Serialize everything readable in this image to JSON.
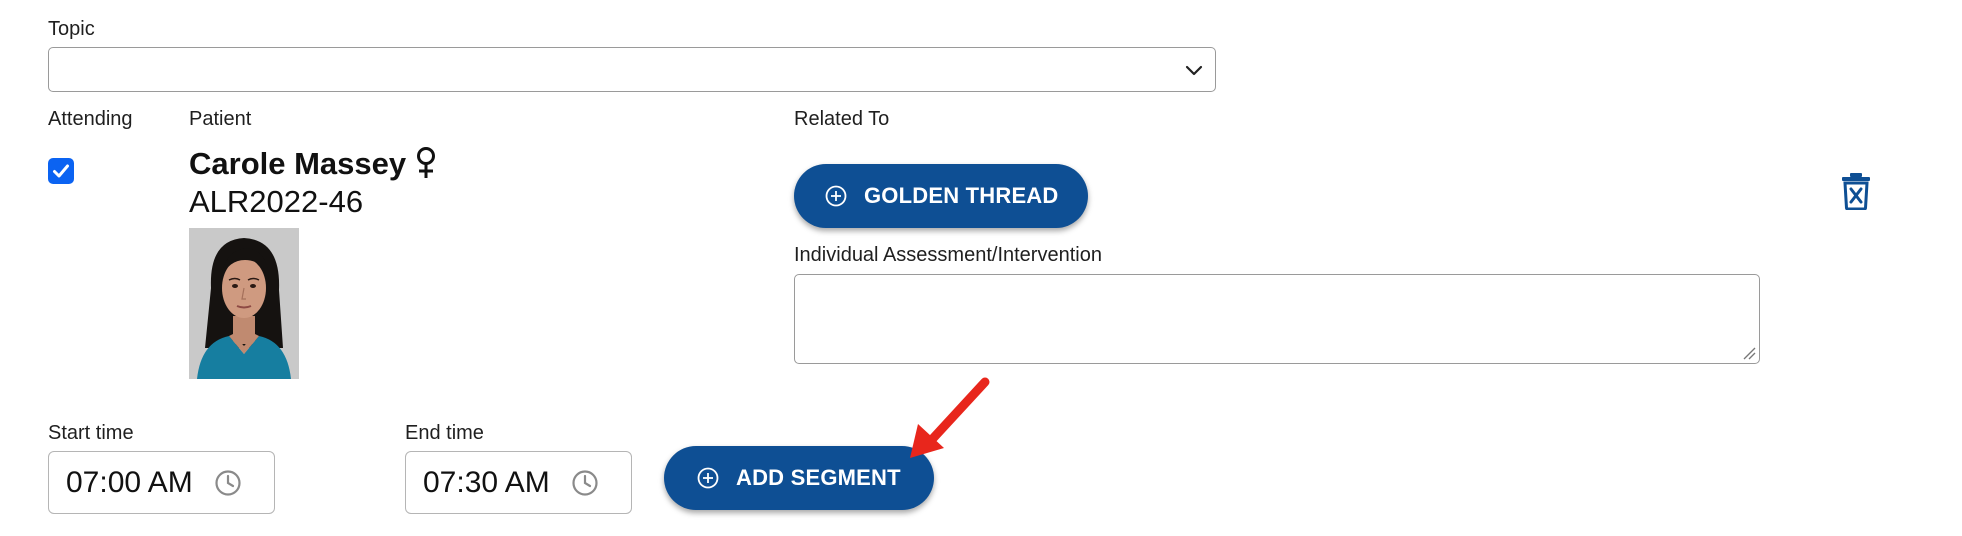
{
  "topic": {
    "label": "Topic",
    "value": ""
  },
  "attending": {
    "label": "Attending",
    "checked": true
  },
  "patient": {
    "label": "Patient",
    "name": "Carole Massey",
    "id": "ALR2022-46",
    "gender_icon": "female-icon"
  },
  "related_to": {
    "label": "Related To",
    "golden_thread_label": "GOLDEN THREAD"
  },
  "assessment": {
    "label": "Individual Assessment/Intervention",
    "value": ""
  },
  "start_time": {
    "label": "Start time",
    "value": "07:00 AM"
  },
  "end_time": {
    "label": "End time",
    "value": "07:30 AM"
  },
  "add_segment_label": "ADD SEGMENT",
  "colors": {
    "primary": "#0e4f94",
    "checkbox": "#0b63f2",
    "annotation_arrow": "#e8261c"
  }
}
